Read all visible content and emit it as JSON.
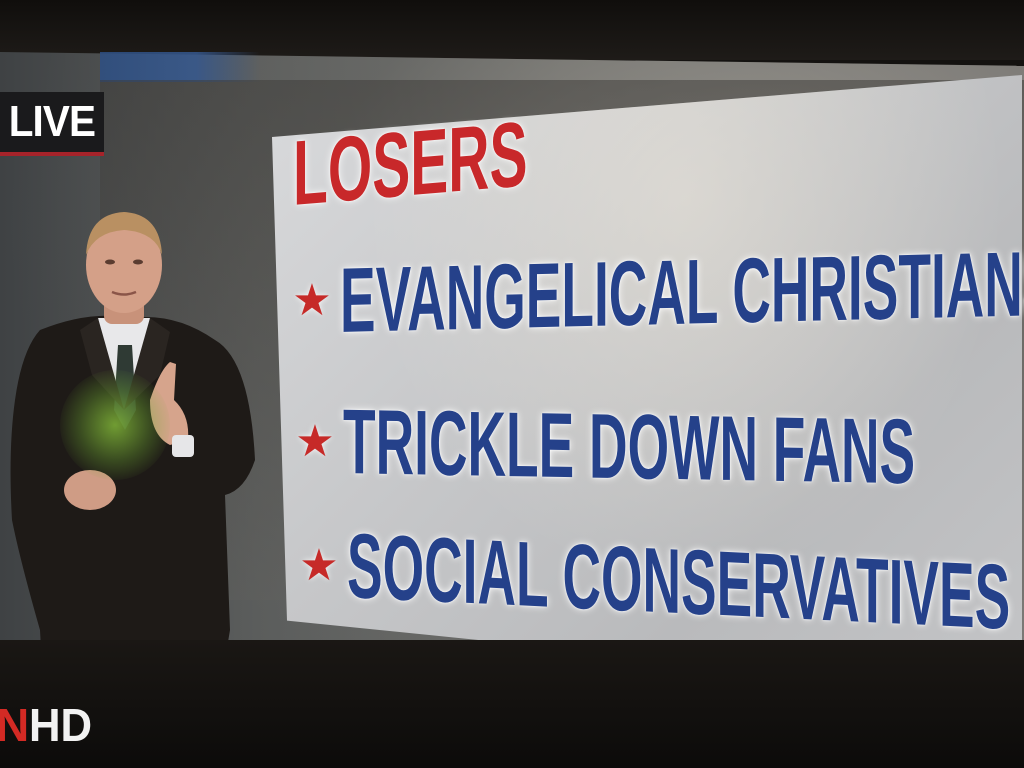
{
  "live_bug": {
    "label": "LIVE"
  },
  "graphic": {
    "heading": "LOSERS",
    "bullet_icon": "star-icon",
    "items": [
      {
        "label": "EVANGELICAL CHRISTIANS"
      },
      {
        "label": "TRICKLE DOWN FANS"
      },
      {
        "label": "SOCIAL CONSERVATIVES"
      }
    ]
  },
  "network_bug": {
    "logo_fragment": "N",
    "label": "HD"
  },
  "colors": {
    "heading": "#c8282a",
    "items": "#25418a",
    "star": "#c62a28",
    "live_underline": "#a6232a"
  }
}
